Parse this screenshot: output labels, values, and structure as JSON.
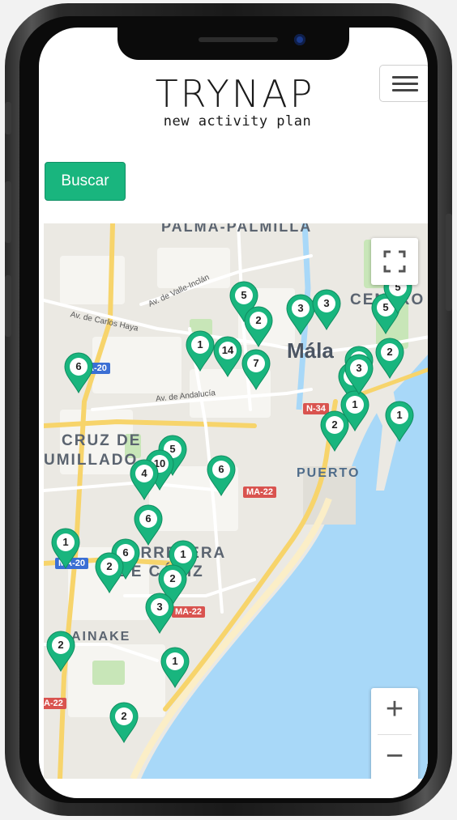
{
  "logo": {
    "title": "TRYNAP",
    "subtitle": "new activity plan"
  },
  "header": {
    "menu_icon": "hamburger-icon",
    "search_label": "Buscar"
  },
  "colors": {
    "accent": "#19b57e",
    "water": "#a8d8f8",
    "road_major": "#f7d46b"
  },
  "map": {
    "area_labels": [
      "PALMA-PALMILLA",
      "CENTRO",
      "Mála",
      "CRUZ DE",
      "UMILLADO",
      "PUERTO",
      "CARRETERA",
      "DE CÁDIZ",
      "AINAKE"
    ],
    "road_labels": [
      "Av. de Valle-Inclán",
      "Av. de Carlos Haya",
      "Av. de Andalucía"
    ],
    "shields": [
      "A-20",
      "N-34",
      "MA-22",
      "MA-20",
      "MA-22",
      "A-22"
    ],
    "markers": [
      "5",
      "3",
      "3",
      "5",
      "2",
      "1",
      "14",
      "7",
      "2",
      "6",
      "3",
      "2",
      "1",
      "1",
      "2",
      "5",
      "10",
      "4",
      "6",
      "6",
      "1",
      "6",
      "1",
      "2",
      "2",
      "3",
      "2",
      "1",
      "2",
      "3",
      "5"
    ],
    "controls": {
      "fullscreen_icon": "fullscreen-icon",
      "zoom_in": "+",
      "zoom_out": "−"
    }
  }
}
